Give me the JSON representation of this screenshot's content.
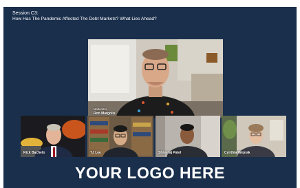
{
  "header": {
    "session_label": "Session C3:",
    "session_title": "How Has The Pandemic Affected The Debt Markets? What Lies Ahead?"
  },
  "main_speaker": {
    "role": "Moderator",
    "name": "Ron Margolis"
  },
  "participants": [
    {
      "name": "Rick Bachelo"
    },
    {
      "name": "TJ Lee"
    },
    {
      "name": "Shreeraj Patel"
    },
    {
      "name": "Cynthia Weprak"
    }
  ],
  "logo": {
    "text": "YOUR LOGO HERE"
  },
  "colors": {
    "background": "#1a2f4c",
    "text": "#ffffff"
  }
}
